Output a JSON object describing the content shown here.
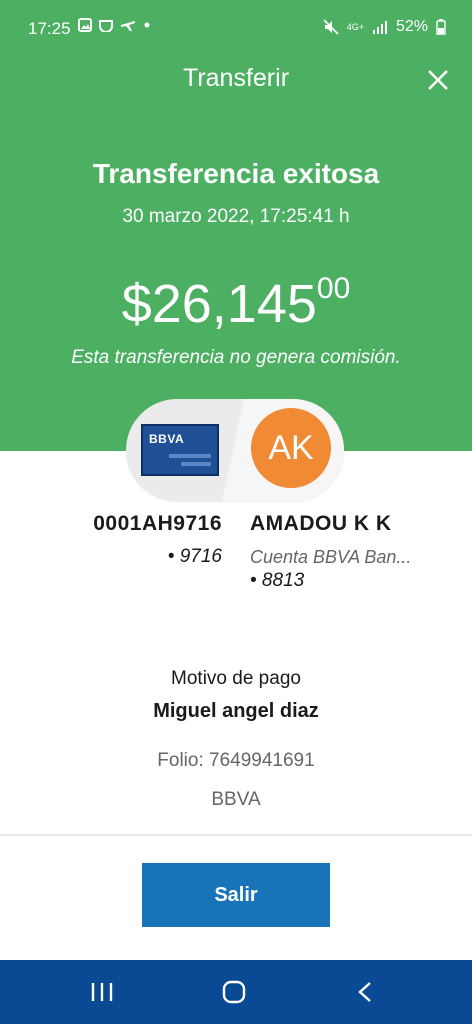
{
  "status_bar": {
    "time": "17:25",
    "signal_label": "4G+",
    "battery": "52%"
  },
  "header": {
    "title": "Transferir"
  },
  "summary": {
    "title": "Transferencia exitosa",
    "datetime": "30 marzo 2022, 17:25:41 h",
    "amount_main": "$26,145",
    "amount_cents": "00",
    "commission_note": "Esta transferencia no genera comisión."
  },
  "origin": {
    "card_brand": "BBVA",
    "account_id": "0001AH9716",
    "account_last": "• 9716"
  },
  "recipient": {
    "initials": "AK",
    "name": "AMADOU K K",
    "bank_account": "Cuenta BBVA Ban...",
    "account_last": "• 8813"
  },
  "details": {
    "motivo_label": "Motivo de pago",
    "motivo_value": "Miguel angel diaz",
    "folio": "Folio: 7649941691",
    "bank": "BBVA"
  },
  "actions": {
    "exit_label": "Salir"
  },
  "colors": {
    "header_green": "#4caf62",
    "button_blue": "#1973b8",
    "nav_blue": "#0a4a94",
    "avatar_orange": "#f08a34"
  }
}
